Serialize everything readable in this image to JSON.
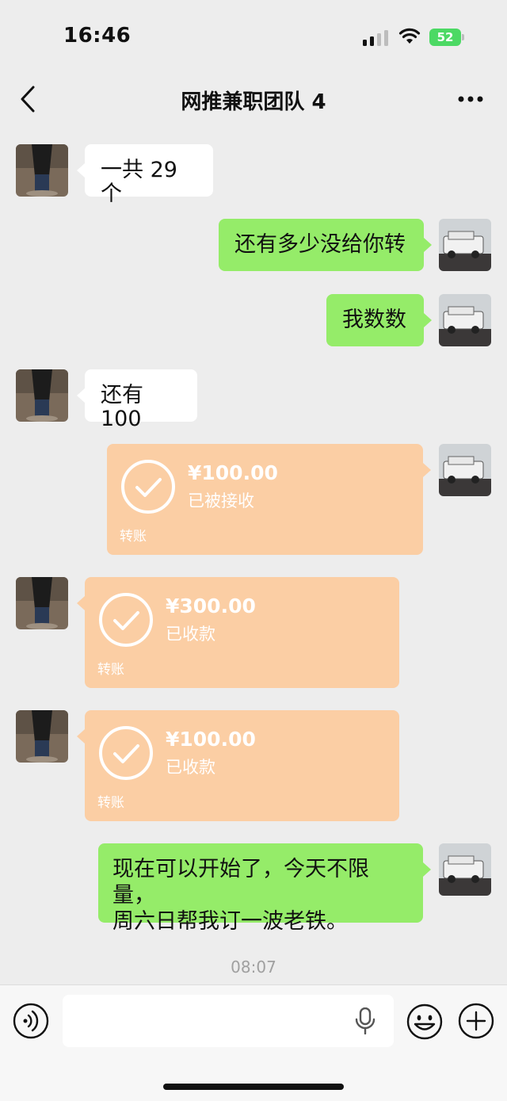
{
  "status_bar": {
    "time": "16:46",
    "battery_level": "52",
    "icons": [
      "signal-icon",
      "wifi-icon",
      "battery-charging-icon"
    ]
  },
  "header": {
    "title": "网推兼职团队 4",
    "back_icon": "chevron-left-icon",
    "more_icon": "more-dots-icon"
  },
  "messages": [
    {
      "side": "left",
      "type": "text",
      "text": "一共 29 个"
    },
    {
      "side": "right",
      "type": "text",
      "text": "还有多少没给你转"
    },
    {
      "side": "right",
      "type": "text",
      "text": "我数数"
    },
    {
      "side": "left",
      "type": "text",
      "text": "还有 100"
    },
    {
      "side": "right",
      "type": "transfer",
      "amount": "¥100.00",
      "status": "已被接收",
      "kind": "转账"
    },
    {
      "side": "left",
      "type": "transfer",
      "amount": "¥300.00",
      "status": "已收款",
      "kind": "转账"
    },
    {
      "side": "left",
      "type": "transfer",
      "amount": "¥100.00",
      "status": "已收款",
      "kind": "转账"
    },
    {
      "side": "right",
      "type": "text",
      "lines": [
        "现在可以开始了，今天不限量，",
        "周六日帮我订一波老铁。"
      ]
    }
  ],
  "timestamp": "08:07",
  "input_bar": {
    "placeholder": "",
    "icons": [
      "voice-icon",
      "mic-icon",
      "emoji-icon",
      "plus-icon"
    ]
  },
  "colors": {
    "background": "#ededed",
    "outgoing_bubble": "#95ec69",
    "incoming_bubble": "#ffffff",
    "transfer_bubble": "#fbcea4"
  }
}
